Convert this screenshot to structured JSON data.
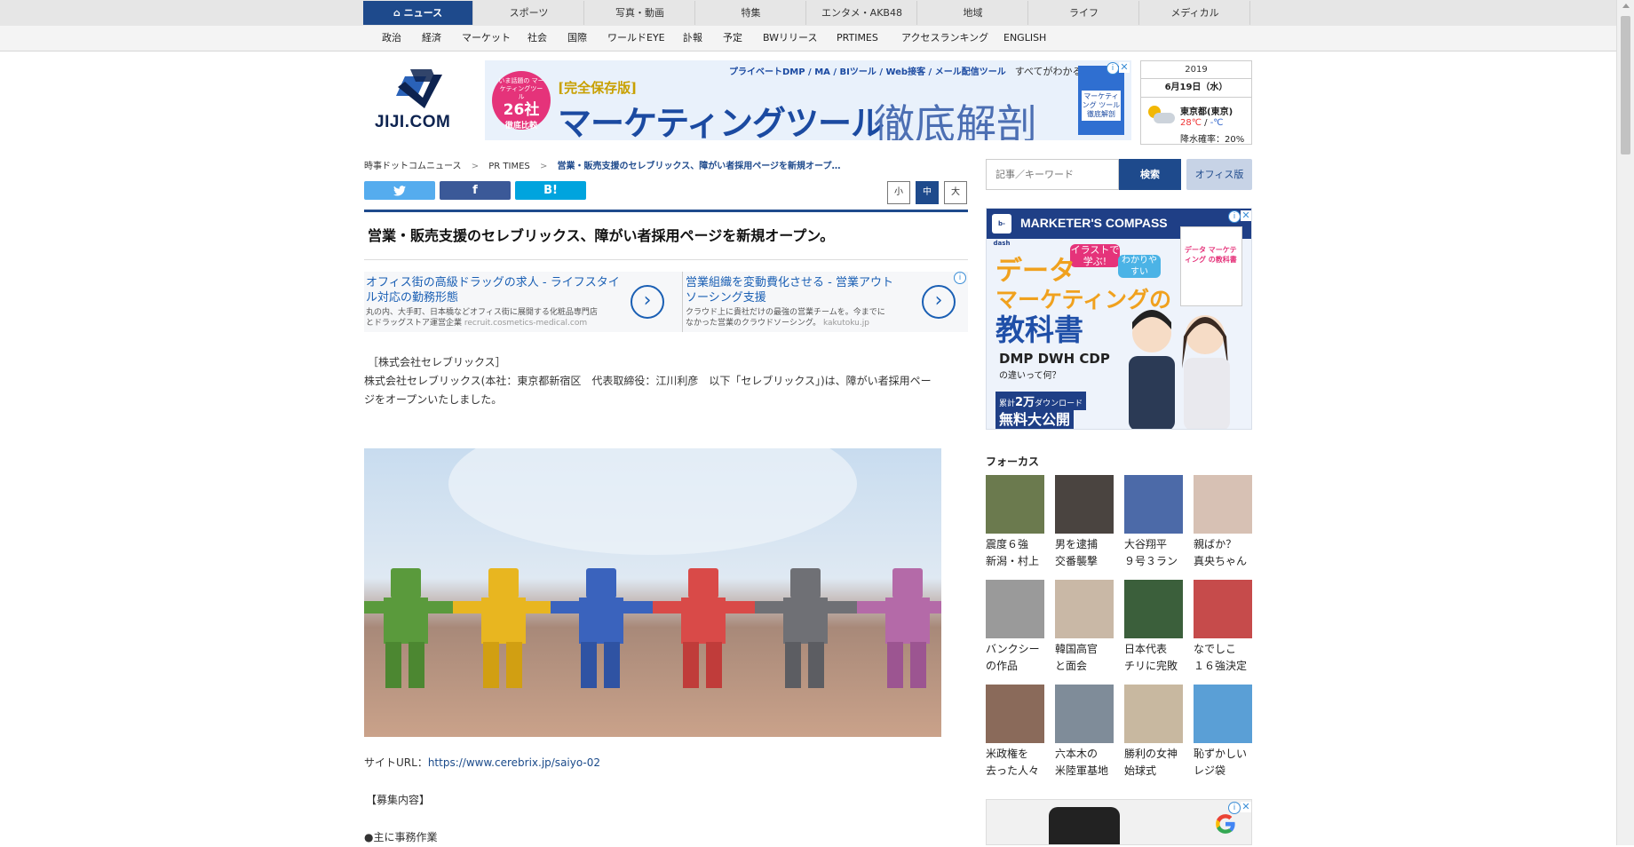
{
  "top_nav": {
    "tabs": [
      "ニュース",
      "スポーツ",
      "写真・動画",
      "特集",
      "エンタメ・AKB48",
      "地域",
      "ライフ",
      "メディカル"
    ],
    "active": "ニュース"
  },
  "sub_nav": [
    "政治",
    "経済",
    "マーケット",
    "社会",
    "国際",
    "ワールドEYE",
    "訃報",
    "予定",
    "BWリリース",
    "PRTIMES",
    "アクセスランキング",
    "ENGLISH"
  ],
  "logo": {
    "text": "JIJI.COM"
  },
  "banner_ad": {
    "circle_top": "いま話題の マーケティングツール",
    "circle_big": "26社",
    "circle_bottom": "徹底比較",
    "tag": "[完全保存版]",
    "headline": "マーケティングツール",
    "headline2": "徹底解剖",
    "top_line": "プライベートDMP / MA / BIツール / Web接客 / メール配信ツール",
    "top_line2": "すべてがわかる一冊。",
    "book": "マーケティング ツール 徹底解剖"
  },
  "weather": {
    "year": "2019",
    "date": "6月19日（水）",
    "city": "東京都(東京)",
    "temp_high": "28℃",
    "temp_sep": " / ",
    "temp_low": "-℃",
    "rain": "降水確率：20%"
  },
  "breadcrumb": [
    "時事ドットコムニュース",
    "PR TIMES",
    "営業・販売支援のセレブリックス、障がい者採用ページを新規オープ…"
  ],
  "breadcrumb_sep": ">",
  "share": {
    "twitter": "twitter-icon",
    "facebook": "f",
    "hatena": "B!"
  },
  "font_size": {
    "small": "小",
    "medium": "中",
    "large": "大"
  },
  "article": {
    "headline": "営業・販売支援のセレブリックス、障がい者採用ページを新規オープン。",
    "company": "［株式会社セレブリックス］",
    "lead_1": "株式会社セレブリックス(本社：東京都新宿区　代表取締役：江川利彦　以下「セレブリックス」)は、障がい者採用ペー",
    "lead_2": "ジをオープンいたしました。",
    "site_label": "サイトURL：",
    "site_url": "https://www.cerebrix.jp/saiyo-02",
    "recruit_heading": "【募集内容】",
    "recruit_item": "●主に事務作業"
  },
  "text_ads": [
    {
      "title": "オフィス街の高級ドラッグの求人 - ライフスタイル対応の勤務形態",
      "desc_1": "丸の内、大手町、日本橋などオフィス街に展開する化粧品専門店",
      "desc_2": "とドラッグストア運営企業",
      "domain": "recruit.cosmetics-medical.com"
    },
    {
      "title": "営業組織を変動費化させる - 営業アウトソーシング支援",
      "desc_1": "クラウド上に貴社だけの最強の営業チームを。今までに",
      "desc_2": "なかった営業のクラウドソーシング。",
      "domain": "kakutoku.jp"
    }
  ],
  "search": {
    "placeholder": "記事／キーワード",
    "button": "検索",
    "office": "オフィス版"
  },
  "right_ad": {
    "brand": "MARKETER'S COMPASS",
    "bubble_1": "イラストで学ぶ!",
    "bubble_2": "わかりやすい",
    "line_1": "データ",
    "line_2": "マーケティングの",
    "line_3": "教科書",
    "line_4": "DMP DWH CDP",
    "line_5": "の違いって何？",
    "dl_prefix": "累計",
    "dl_count": "2万",
    "dl_suffix": "ダウンロード",
    "free": "無料大公開",
    "bdash": "b-dash",
    "book_title": "データ マーケティング の教科書"
  },
  "focus": {
    "title": "フォーカス",
    "items": [
      {
        "l1": "震度６強",
        "l2": "新潟・村上",
        "color": "#6b7a4e"
      },
      {
        "l1": "男を逮捕",
        "l2": "交番襲撃",
        "color": "#4a4440"
      },
      {
        "l1": "大谷翔平",
        "l2": "９号３ラン",
        "color": "#4c6aa8"
      },
      {
        "l1": "親ばか？",
        "l2": "真央ちゃん",
        "color": "#d7c1b4"
      },
      {
        "l1": "バンクシー",
        "l2": "の作品",
        "color": "#9a9a9a"
      },
      {
        "l1": "韓国高官",
        "l2": "と面会",
        "color": "#c9b8a6"
      },
      {
        "l1": "日本代表",
        "l2": "チリに完敗",
        "color": "#3b5f3b"
      },
      {
        "l1": "なでしこ",
        "l2": "１６強決定",
        "color": "#c64b4b"
      },
      {
        "l1": "米政権を",
        "l2": "去った人々",
        "color": "#8a6a5a"
      },
      {
        "l1": "六本木の",
        "l2": "米陸軍基地",
        "color": "#7f8c99"
      },
      {
        "l1": "勝利の女神",
        "l2": "始球式",
        "color": "#c8b8a0"
      },
      {
        "l1": "恥ずかしい",
        "l2": "レジ袋",
        "color": "#5a9fd6"
      }
    ]
  },
  "colors": {
    "brand": "#1e4a8c",
    "link": "#1a5fb4",
    "twitter": "#55acee",
    "facebook": "#3b5998",
    "hatena": "#00a4de"
  }
}
